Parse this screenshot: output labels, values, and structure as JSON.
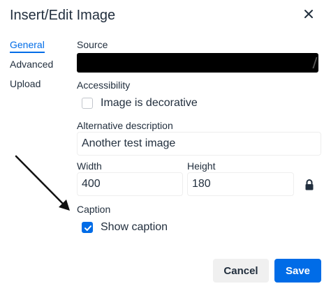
{
  "dialog": {
    "title": "Insert/Edit Image"
  },
  "tabs": [
    {
      "label": "General",
      "active": true
    },
    {
      "label": "Advanced",
      "active": false
    },
    {
      "label": "Upload",
      "active": false
    }
  ],
  "form": {
    "source_label": "Source",
    "source_value": "",
    "accessibility_label": "Accessibility",
    "decorative_label": "Image is decorative",
    "decorative_checked": false,
    "alt_label": "Alternative description",
    "alt_value": "Another test image",
    "width_label": "Width",
    "width_value": "400",
    "height_label": "Height",
    "height_value": "180",
    "caption_label": "Caption",
    "show_caption_label": "Show caption",
    "show_caption_checked": true
  },
  "buttons": {
    "cancel_label": "Cancel",
    "save_label": "Save"
  },
  "icons": {
    "close": "close-icon",
    "lock": "lock-icon",
    "check": "checkmark-icon"
  },
  "colors": {
    "accent": "#006ce7",
    "text": "#222f3e",
    "border": "#eeeeee"
  }
}
